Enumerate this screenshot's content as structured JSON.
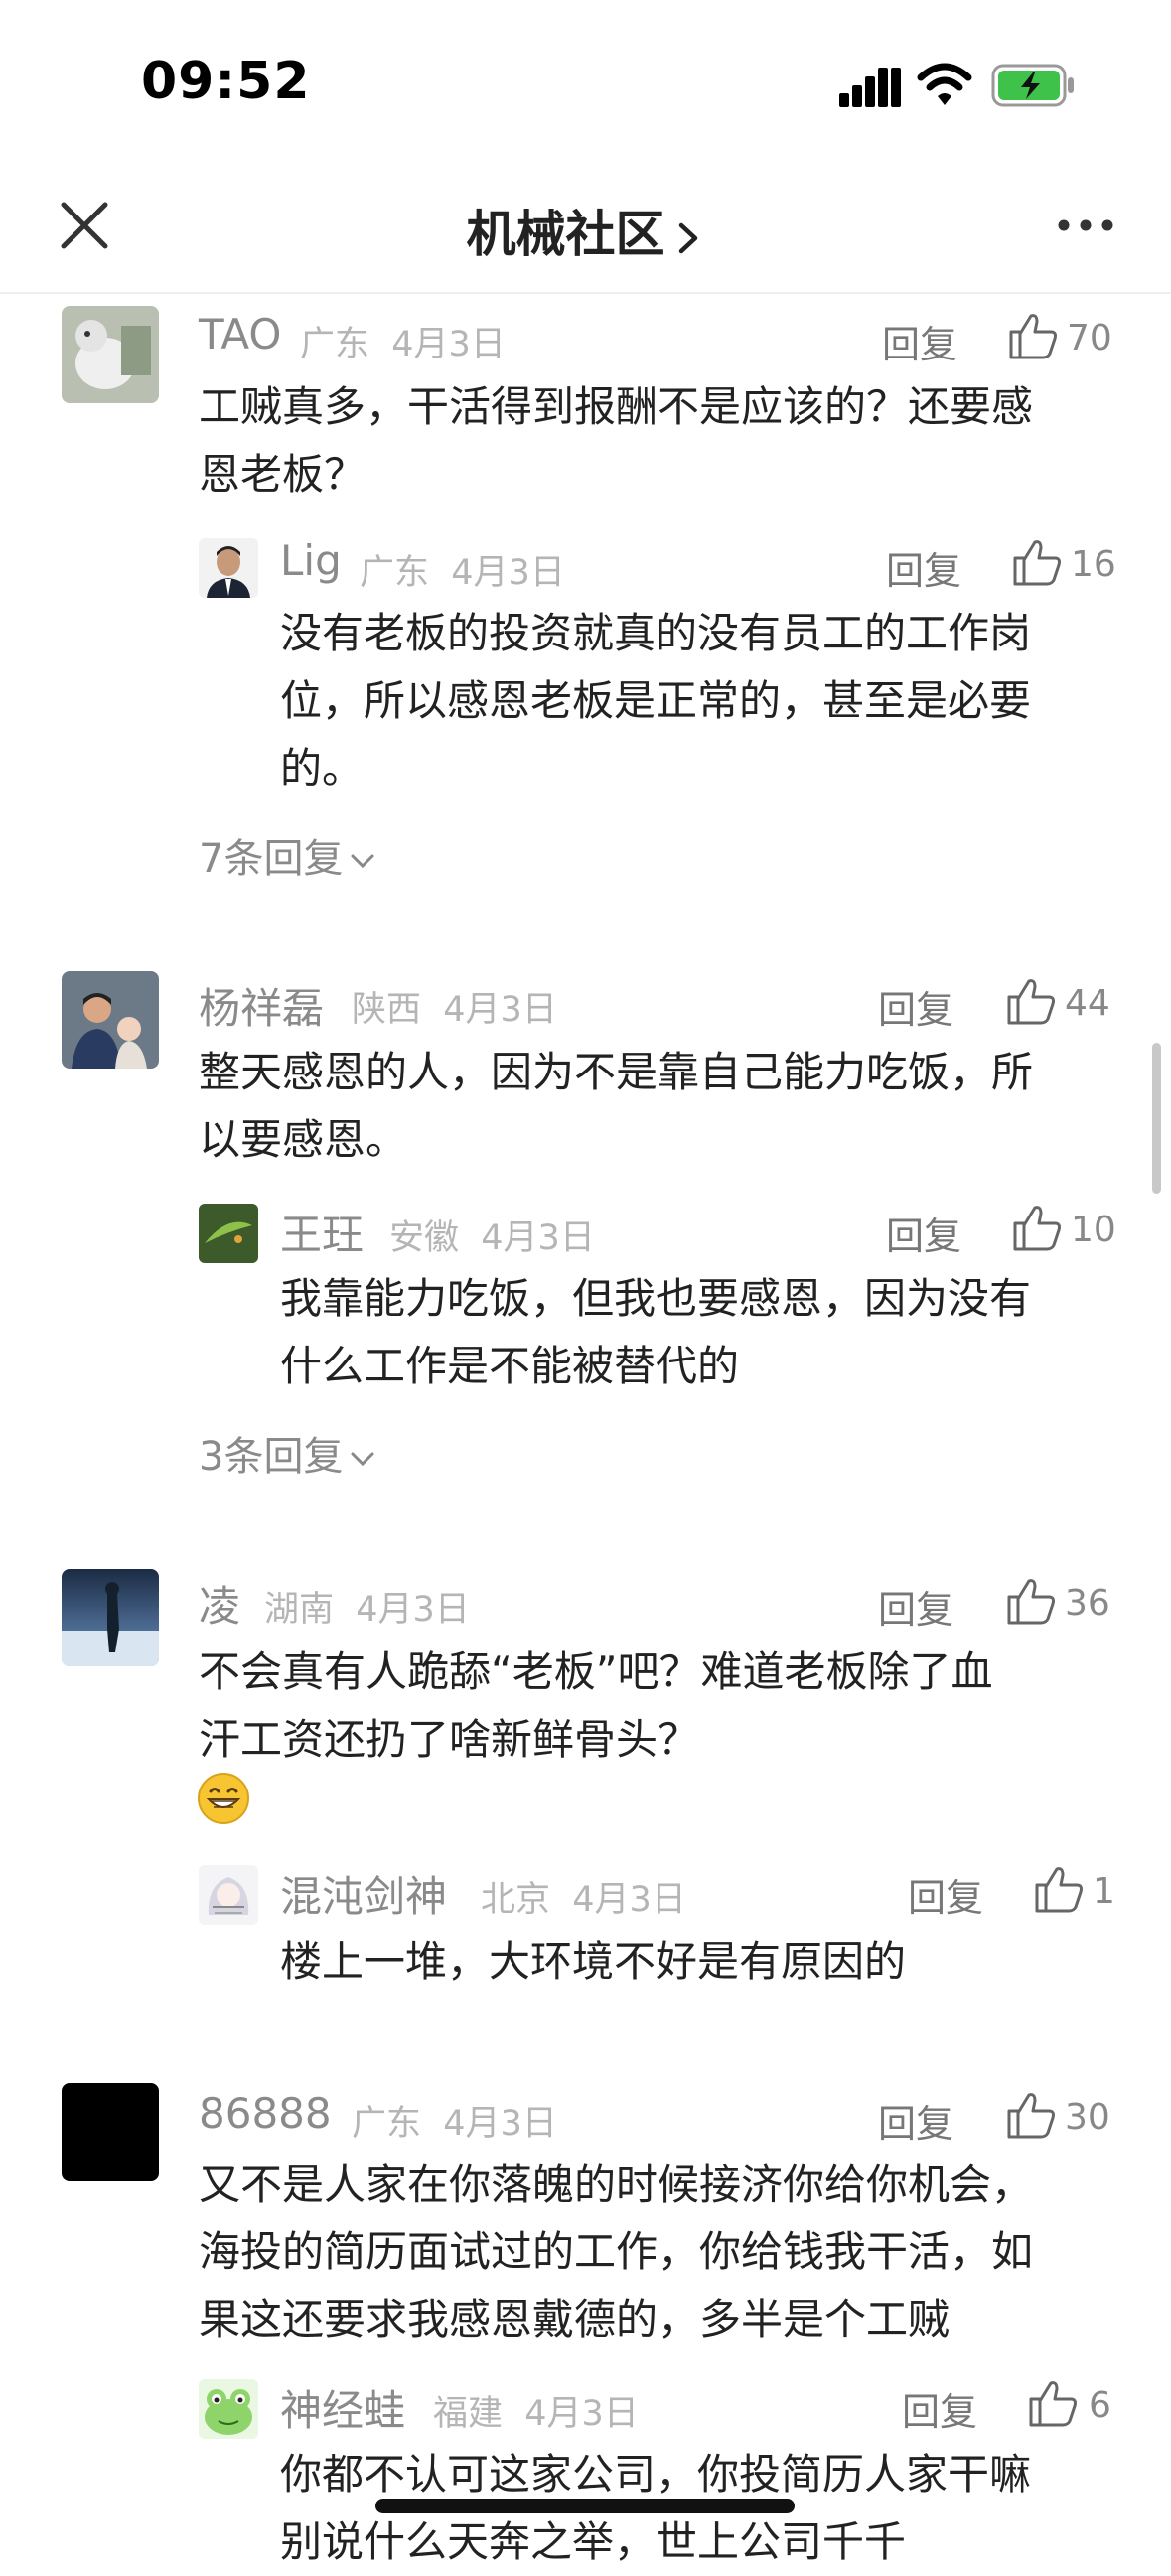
{
  "status_bar": {
    "time": "09:52"
  },
  "header": {
    "title": "机械社区"
  },
  "comments": [
    {
      "user": "TAO",
      "region": "广东",
      "date": "4月3日",
      "reply_label": "回复",
      "likes": "70",
      "lines": [
        "工贼真多，干活得到报酬不是应该的？还要感",
        "恩老板？"
      ],
      "reply": {
        "user": "Lig",
        "region": "广东",
        "date": "4月3日",
        "reply_label": "回复",
        "likes": "16",
        "lines": [
          "没有老板的投资就真的没有员工的工作岗",
          "位，所以感恩老板是正常的，甚至是必要",
          "的。"
        ]
      },
      "more_replies": "7条回复"
    },
    {
      "user": "杨祥磊",
      "region": "陕西",
      "date": "4月3日",
      "reply_label": "回复",
      "likes": "44",
      "lines": [
        "整天感恩的人，因为不是靠自己能力吃饭，所",
        "以要感恩。"
      ],
      "reply": {
        "user": "王玨",
        "region": "安徽",
        "date": "4月3日",
        "reply_label": "回复",
        "likes": "10",
        "lines": [
          "我靠能力吃饭，但我也要感恩，因为没有",
          "什么工作是不能被替代的"
        ]
      },
      "more_replies": "3条回复"
    },
    {
      "user": "凌",
      "region": "湖南",
      "date": "4月3日",
      "reply_label": "回复",
      "likes": "36",
      "lines": [
        "不会真有人跪舔“老板”吧？难道老板除了血",
        "汗工资还扔了啥新鲜骨头？"
      ],
      "emoji": "grin-emoji",
      "reply": {
        "user": "混沌剑神",
        "region": "北京",
        "date": "4月3日",
        "reply_label": "回复",
        "likes": "1",
        "lines": [
          "楼上一堆，大环境不好是有原因的"
        ]
      }
    },
    {
      "user": "86888",
      "region": "广东",
      "date": "4月3日",
      "reply_label": "回复",
      "likes": "30",
      "lines": [
        "又不是人家在你落魄的时候接济你给你机会，",
        "海投的简历面试过的工作，你给钱我干活，如",
        "果这还要求我感恩戴德的，多半是个工贼"
      ],
      "reply": {
        "user": "神经蛙",
        "region": "福建",
        "date": "4月3日",
        "reply_label": "回复",
        "likes": "6",
        "lines": [
          "你都不认可这家公司，你投简历人家干嘛",
          "别说什么天奔之举，世上公司千千"
        ]
      }
    }
  ],
  "colors": {
    "accent_green": "#3ec24a",
    "text": "#222222",
    "muted": "#8a8a8a",
    "meta": "#b5b5b5"
  }
}
